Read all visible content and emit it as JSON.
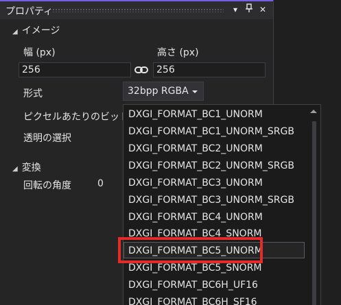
{
  "window": {
    "title": "プロパティ",
    "buttons": [
      "▾",
      "⊓",
      "✕"
    ]
  },
  "image_section": {
    "header": "イメージ",
    "width_label": "幅 (px)",
    "height_label": "高さ (px)",
    "width_value": "256",
    "height_value": "256",
    "format_label": "形式",
    "format_value": "32bpp RGBA",
    "bits_label": "ピクセルあたりのビット数",
    "transparency_label": "透明の選択"
  },
  "transform_section": {
    "header": "変換",
    "rotation_label": "回転の角度",
    "rotation_value": "0"
  },
  "dropdown": {
    "options": [
      "DXGI_FORMAT_BC1_UNORM",
      "DXGI_FORMAT_BC1_UNORM_SRGB",
      "DXGI_FORMAT_BC2_UNORM",
      "DXGI_FORMAT_BC2_UNORM_SRGB",
      "DXGI_FORMAT_BC3_UNORM",
      "DXGI_FORMAT_BC3_UNORM_SRGB",
      "DXGI_FORMAT_BC4_UNORM",
      "DXGI_FORMAT_BC4_SNORM",
      "DXGI_FORMAT_BC5_UNORM",
      "DXGI_FORMAT_BC5_SNORM",
      "DXGI_FORMAT_BC6H_UF16",
      "DXGI_FORMAT_BC6H_SF16"
    ],
    "highlighted": "DXGI_FORMAT_BC5_UNORM"
  },
  "colors": {
    "accent": "#7160e8",
    "highlight": "#e52a2a"
  }
}
